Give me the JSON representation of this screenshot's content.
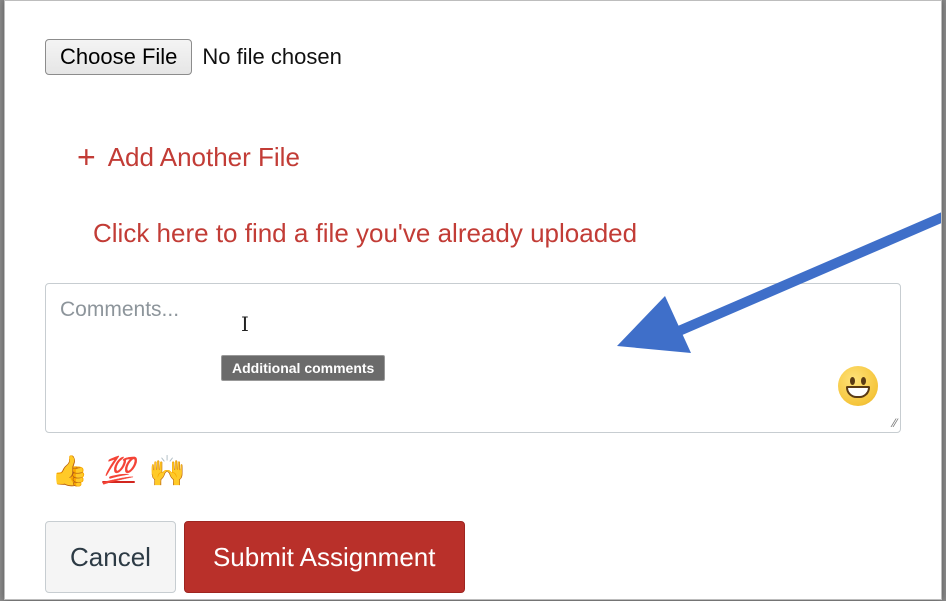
{
  "file_upload": {
    "choose_button_label": "Choose File",
    "status_text": "No file chosen"
  },
  "add_another_file": {
    "icon": "plus-icon",
    "label": "Add Another File"
  },
  "find_uploaded_link": "Click here to find a file you've already uploaded",
  "comments": {
    "placeholder": "Comments...",
    "value": "",
    "tooltip": "Additional comments",
    "emoji_picker_icon": "smiley-face-icon"
  },
  "quick_emojis": [
    {
      "name": "thumbs-up",
      "glyph": "👍"
    },
    {
      "name": "hundred",
      "glyph": "💯"
    },
    {
      "name": "raised-hands",
      "glyph": "🙌"
    }
  ],
  "actions": {
    "cancel_label": "Cancel",
    "submit_label": "Submit Assignment"
  },
  "colors": {
    "link_red": "#c23c36",
    "submit_red": "#b9302a",
    "annotation_arrow": "#3f6fc9"
  }
}
